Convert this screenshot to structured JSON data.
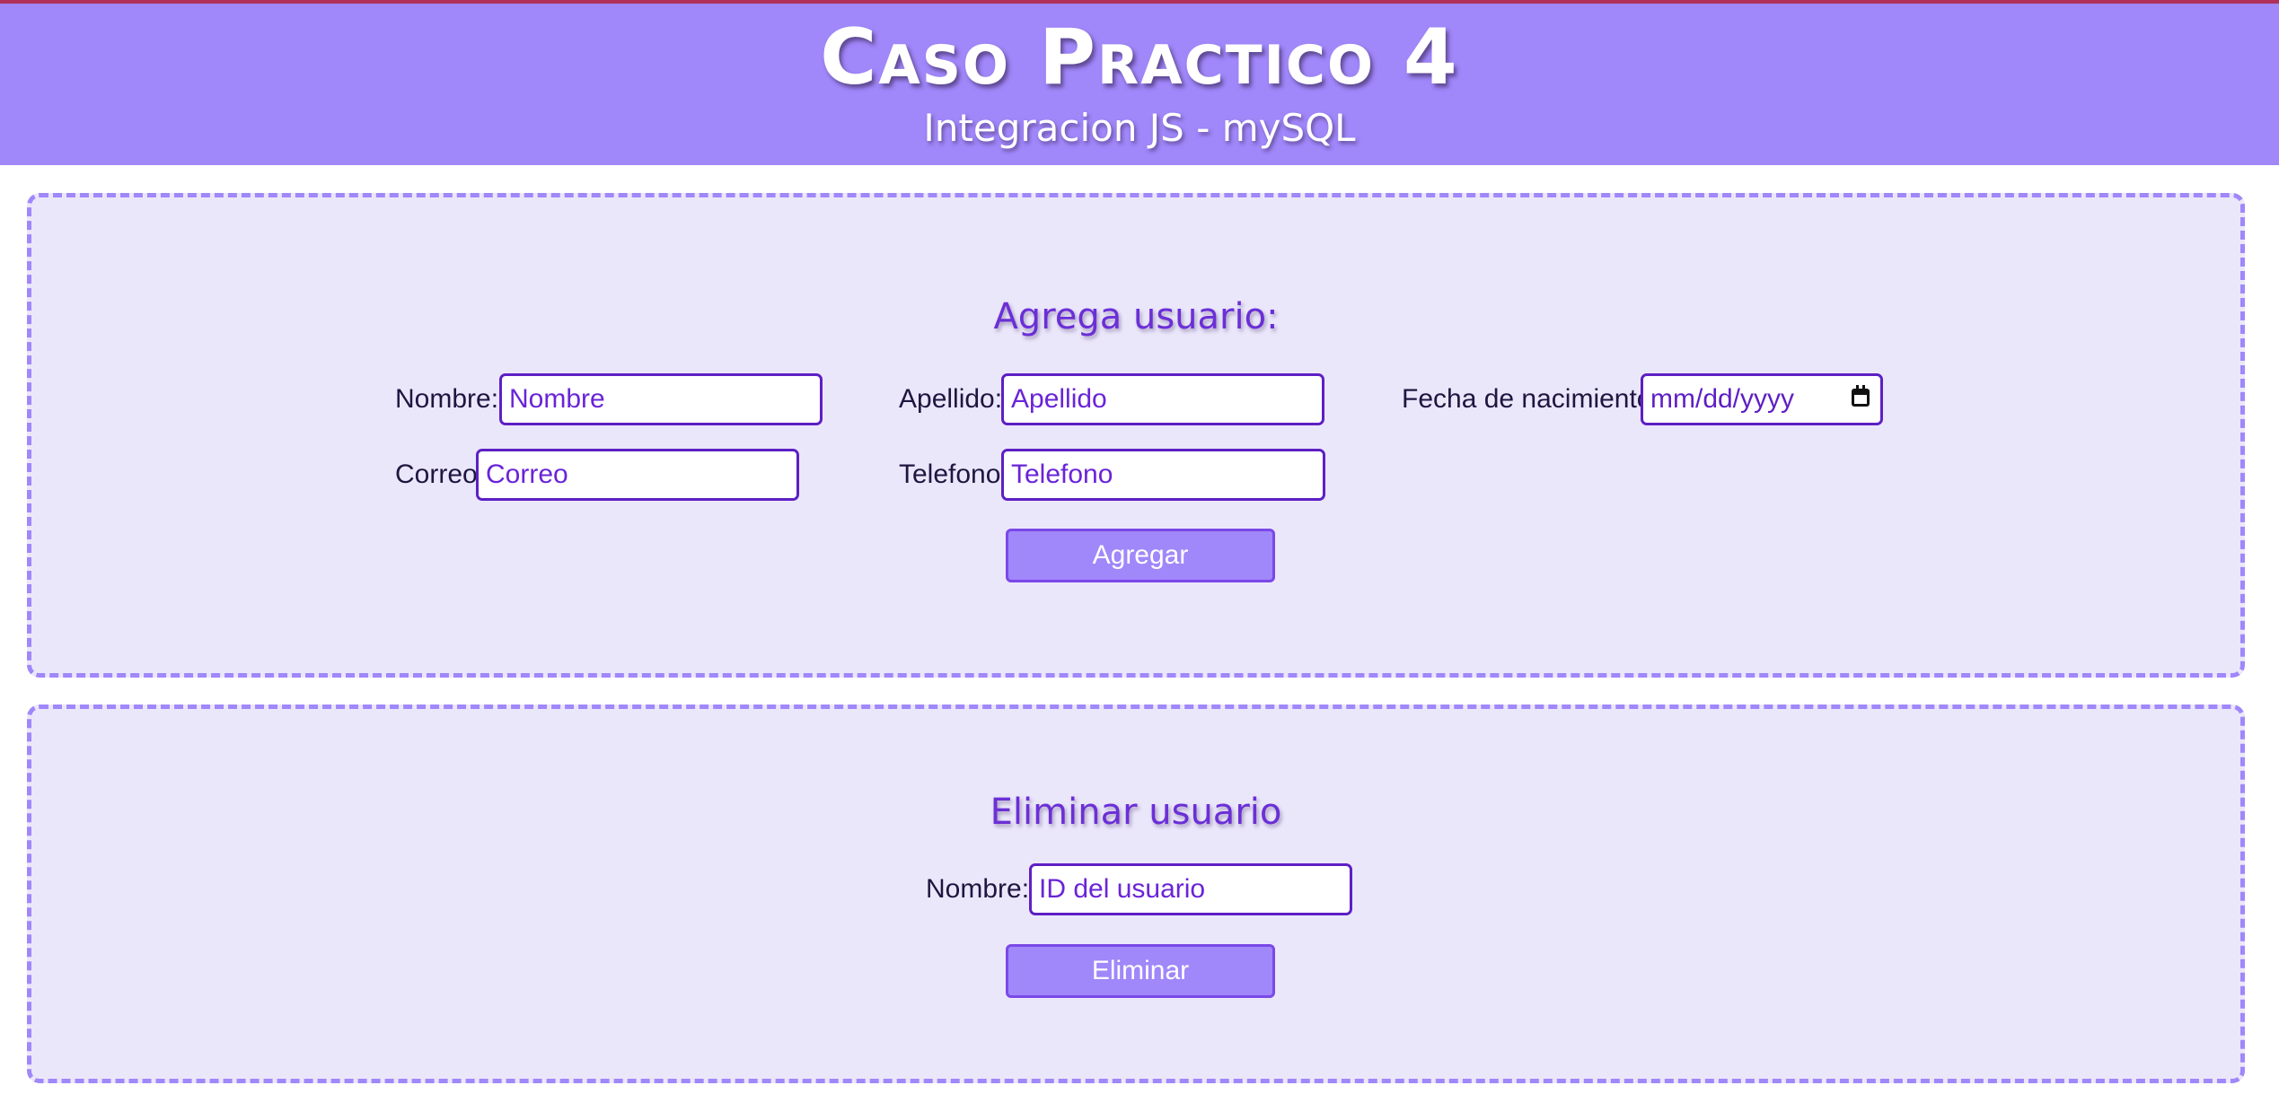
{
  "header": {
    "title": "Caso Practico 4",
    "subtitle": "Integracion JS - mySQL"
  },
  "add_user": {
    "heading": "Agrega usuario:",
    "nombre": {
      "label": "Nombre:",
      "placeholder": "Nombre"
    },
    "apellido": {
      "label": "Apellido:",
      "placeholder": "Apellido"
    },
    "fecha": {
      "label": "Fecha de nacimiento",
      "placeholder": "mm/dd/yyyy"
    },
    "correo": {
      "label": "Correo",
      "placeholder": "Correo"
    },
    "telefono": {
      "label": "Telefono",
      "placeholder": "Telefono"
    },
    "submit_label": "Agregar"
  },
  "delete_user": {
    "heading": "Eliminar usuario",
    "id_field": {
      "label": "Nombre:",
      "placeholder": "ID del usuario"
    },
    "submit_label": "Eliminar"
  },
  "colors": {
    "header_bg": "#a087fa",
    "panel_bg": "#ebe7fb",
    "accent": "#5d1fc4",
    "top_line": "#b0305a"
  },
  "icons": {
    "date_picker": "calendar-icon"
  }
}
